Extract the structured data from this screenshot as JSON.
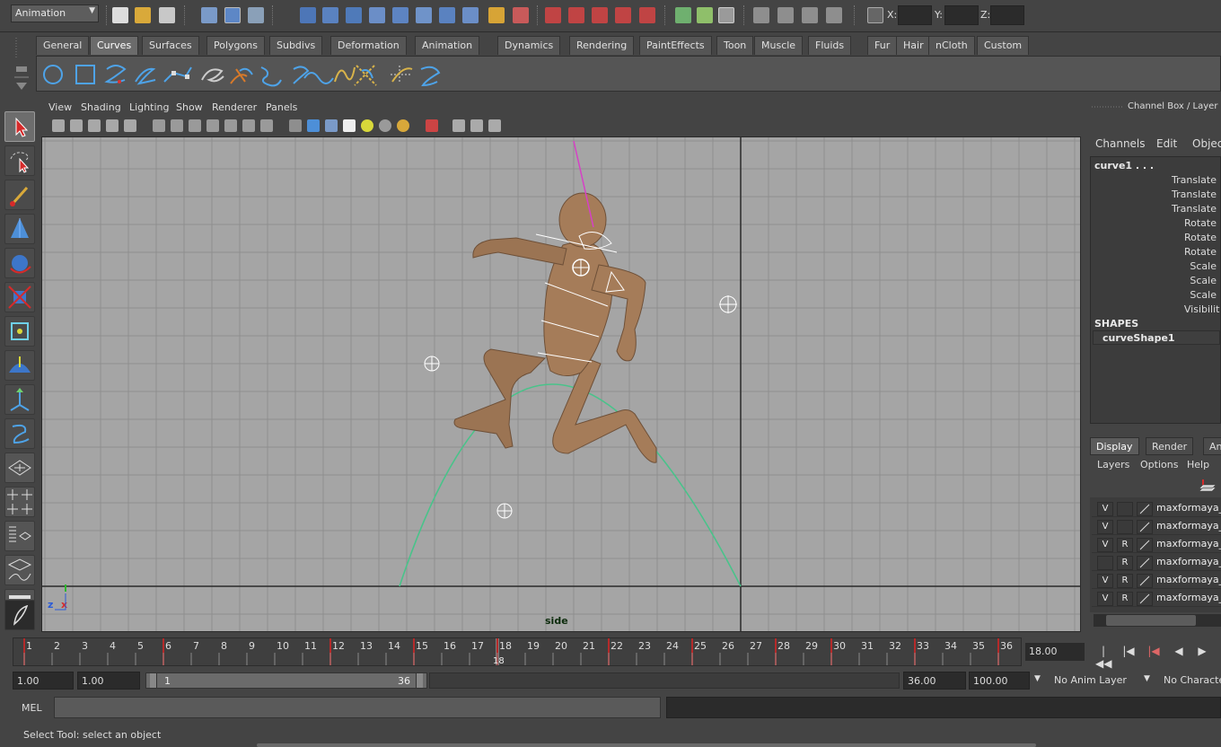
{
  "status_line": {
    "mode": "Animation",
    "x_label": "X:",
    "y_label": "Y:",
    "z_label": "Z:"
  },
  "shelf": {
    "tabs": [
      {
        "label": "General"
      },
      {
        "label": "Curves",
        "active": true
      },
      {
        "label": "Surfaces"
      },
      {
        "label": "Polygons"
      },
      {
        "label": "Subdivs"
      },
      {
        "label": "Deformation"
      },
      {
        "label": "Animation"
      },
      {
        "label": "Dynamics"
      },
      {
        "label": "Rendering"
      },
      {
        "label": "PaintEffects"
      },
      {
        "label": "Toon"
      },
      {
        "label": "Muscle"
      },
      {
        "label": "Fluids"
      },
      {
        "label": "Fur"
      },
      {
        "label": "Hair"
      },
      {
        "label": "nCloth"
      },
      {
        "label": "Custom"
      }
    ],
    "icons": [
      "nurbs-circle-icon",
      "nurbs-square-icon",
      "cv-curve-icon",
      "ep-curve-icon",
      "pencil-curve-icon",
      "arc-three-point-icon",
      "attach-curves-icon",
      "detach-curves-icon",
      "align-curves-icon",
      "open-close-curve-icon",
      "cut-curve-icon",
      "intersect-curves-icon",
      "curve-fillet-icon",
      "insert-knot-icon",
      "rebuild-curve-icon"
    ]
  },
  "panel": {
    "menus": [
      "View",
      "Shading",
      "Lighting",
      "Show",
      "Renderer",
      "Panels"
    ],
    "camera_label": "side"
  },
  "channel_box": {
    "title": "Channel Box / Layer Editor",
    "menus": [
      "Channels",
      "Edit",
      "Object"
    ],
    "node": "curve1 . . .",
    "attributes": [
      "Translate",
      "Translate",
      "Translate",
      "Rotate",
      "Rotate",
      "Rotate",
      "Scale",
      "Scale",
      "Scale",
      "Visibility"
    ],
    "shapes_header": "SHAPES",
    "shape_node": "curveShape1"
  },
  "layer_editor": {
    "tabs": [
      {
        "label": "Display",
        "active": true
      },
      {
        "label": "Render"
      },
      {
        "label": "An"
      }
    ],
    "menus": [
      "Layers",
      "Options",
      "Help"
    ],
    "layers": [
      {
        "v": "V",
        "r": "",
        "name": "maxformaya_v"
      },
      {
        "v": "V",
        "r": "",
        "name": "maxformaya_v"
      },
      {
        "v": "V",
        "r": "R",
        "name": "maxformaya_v"
      },
      {
        "v": "",
        "r": "R",
        "name": "maxformaya_v"
      },
      {
        "v": "V",
        "r": "R",
        "name": "maxformaya_v"
      },
      {
        "v": "V",
        "r": "R",
        "name": "maxformaya_v"
      }
    ]
  },
  "time_slider": {
    "ticks": [
      "1",
      "2",
      "3",
      "4",
      "5",
      "6",
      "7",
      "8",
      "9",
      "10",
      "11",
      "12",
      "13",
      "14",
      "15",
      "16",
      "17",
      "18",
      "19",
      "20",
      "21",
      "22",
      "23",
      "24",
      "25",
      "26",
      "27",
      "28",
      "29",
      "30",
      "31",
      "32",
      "33",
      "34",
      "35",
      "36"
    ],
    "current_frame_marker": "18",
    "current_frame_value": "18.00",
    "keyframes": [
      1,
      6,
      12,
      15,
      18,
      22,
      25,
      28,
      30,
      33,
      36
    ]
  },
  "range_slider": {
    "start_time": "1.00",
    "playback_start": "1.00",
    "range_start": "1",
    "range_end": "36",
    "playback_end": "36.00",
    "end_time": "100.00",
    "anim_layer": "No Anim Layer",
    "character": "No Character"
  },
  "command_line": {
    "label": "MEL",
    "help": "Select Tool: select an object"
  },
  "colors": {
    "viewport_bg": "#a5a5a5",
    "grid": "#8c8c8c",
    "axis": "#2a2a2a",
    "curve": "#49c38a",
    "skin": "#a07a58",
    "keyframe": "#b52a2a"
  }
}
